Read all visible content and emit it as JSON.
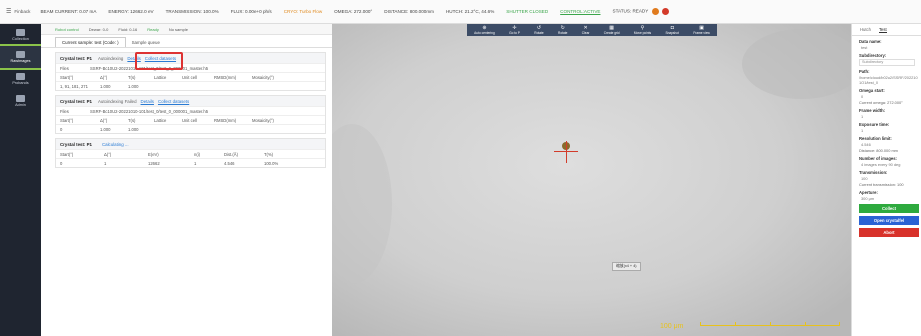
{
  "topbar": {
    "brand": "Finback",
    "beam_current": "BEAM CURRENT: 0.07 mA",
    "energy": "ENERGY: 12662.0 eV",
    "transmission": "TRANSMISSION: 100.0%",
    "flux": "FLUX: 0.00e+0 ph/s",
    "cryo": "CRYO: Turbo Flow",
    "omega": "OMEGA: 272.000°",
    "distance": "DISTANCE: 800.000mm",
    "hutch": "HUTCH: 21.2°C, 44.6%",
    "shutter": "SHUTTER CLOSED",
    "control": "CONTROL:ACTIVE",
    "status": "STATUS: READY"
  },
  "sidebar": {
    "items": [
      {
        "label": "Collection"
      },
      {
        "label": "RawImages"
      },
      {
        "label": "Probands"
      },
      {
        "label": "Admin"
      }
    ]
  },
  "toolstrip": {
    "robot": "Robot control",
    "dewar": "Dewar: 0-0",
    "fluid": "Fluid: 0-16",
    "ready": "Ready",
    "sample": "No sample"
  },
  "tabs": [
    "Current sample: test (Code: )",
    "Sample queue"
  ],
  "blocks": [
    {
      "title": "Crystal test: P1",
      "status": "Autoindexing",
      "link1": "Details",
      "link2": "Collect datasets",
      "file_label": "Files",
      "file_value": "SSRF-Bc10U2-20221010-101/test_0/test_0_000001_master.h5",
      "headers": [
        "Start(°)",
        "Δ(°)",
        "T(s)",
        "Lattice",
        "Unit cell",
        "RMSD(mm)",
        "Mosaicity(°)"
      ],
      "values": [
        "1, 91, 181, 271",
        "1.000",
        "1.000",
        "",
        "",
        "",
        ""
      ]
    },
    {
      "title": "Crystal test: P1",
      "status": "Autoindexing Failed",
      "link1": "Details",
      "link2": "Collect datasets",
      "file_label": "Files",
      "file_value": "SSRF-Bc10U2-20221010-101/test_0/test_0_000001_master.h5",
      "headers": [
        "Start(°)",
        "Δ(°)",
        "T(s)",
        "Lattice",
        "Unit cell",
        "RMSD(mm)",
        "Mosaicity(°)"
      ],
      "values": [
        "0",
        "1.000",
        "1.000",
        "",
        "",
        "",
        ""
      ]
    },
    {
      "title": "Crystal test: P1",
      "status": "Calculating ...",
      "headers": [
        "Start(°)",
        "Δ(°)",
        "E(eV)",
        "n(i)",
        "Dist.(Å)",
        "T(%)"
      ],
      "values": [
        "0",
        "1",
        "12662",
        "1",
        "4.546",
        "100.0%"
      ]
    }
  ],
  "viewer": {
    "tools": [
      "Auto centering",
      "Go to P",
      "Rotate",
      "Rotate",
      "Clear",
      "Create grid",
      "Move points",
      "Snapshot",
      "Frame view"
    ],
    "zoom_label": "缩放(x4 + 4)",
    "scale_label": "100 μm"
  },
  "right": {
    "tabs": [
      "Hutch",
      "Test"
    ],
    "data_name_label": "Data name:",
    "data_name_value": "test",
    "subdir_label": "Subdirectory:",
    "subdir_value": "Subdirectory",
    "path_label": "Path:",
    "path_value": "/home/cloud/b02u2/SSRF/2022101O1/test_0",
    "omega_label": "Omega start:",
    "omega_value": "0",
    "current_omega": "Current omega: 272.000°",
    "frame_label": "Frame width:",
    "frame_value": "1",
    "exposure_label": "Exposure time:",
    "exposure_value": "1",
    "resolution_label": "Resolution limit:",
    "resolution_value": "4.546",
    "distance_text": "Distance: 800.000 mm",
    "images_label": "Number of images:",
    "images_value": "4 images every 90 deg",
    "trans_label": "Transmission:",
    "trans_value": "100",
    "current_trans": "Current transmission: 100",
    "aperture_label": "Aperture:",
    "aperture_value": "300 μm",
    "collect_btn": "Collect",
    "open_btn": "Open crystalfel",
    "abort_btn": "Abort"
  },
  "colors": {
    "collect": "#2eaa3e",
    "open": "#2a62d4",
    "abort": "#d8322a",
    "status_dot1": "#e07b1e",
    "status_dot2": "#d33a2a"
  }
}
